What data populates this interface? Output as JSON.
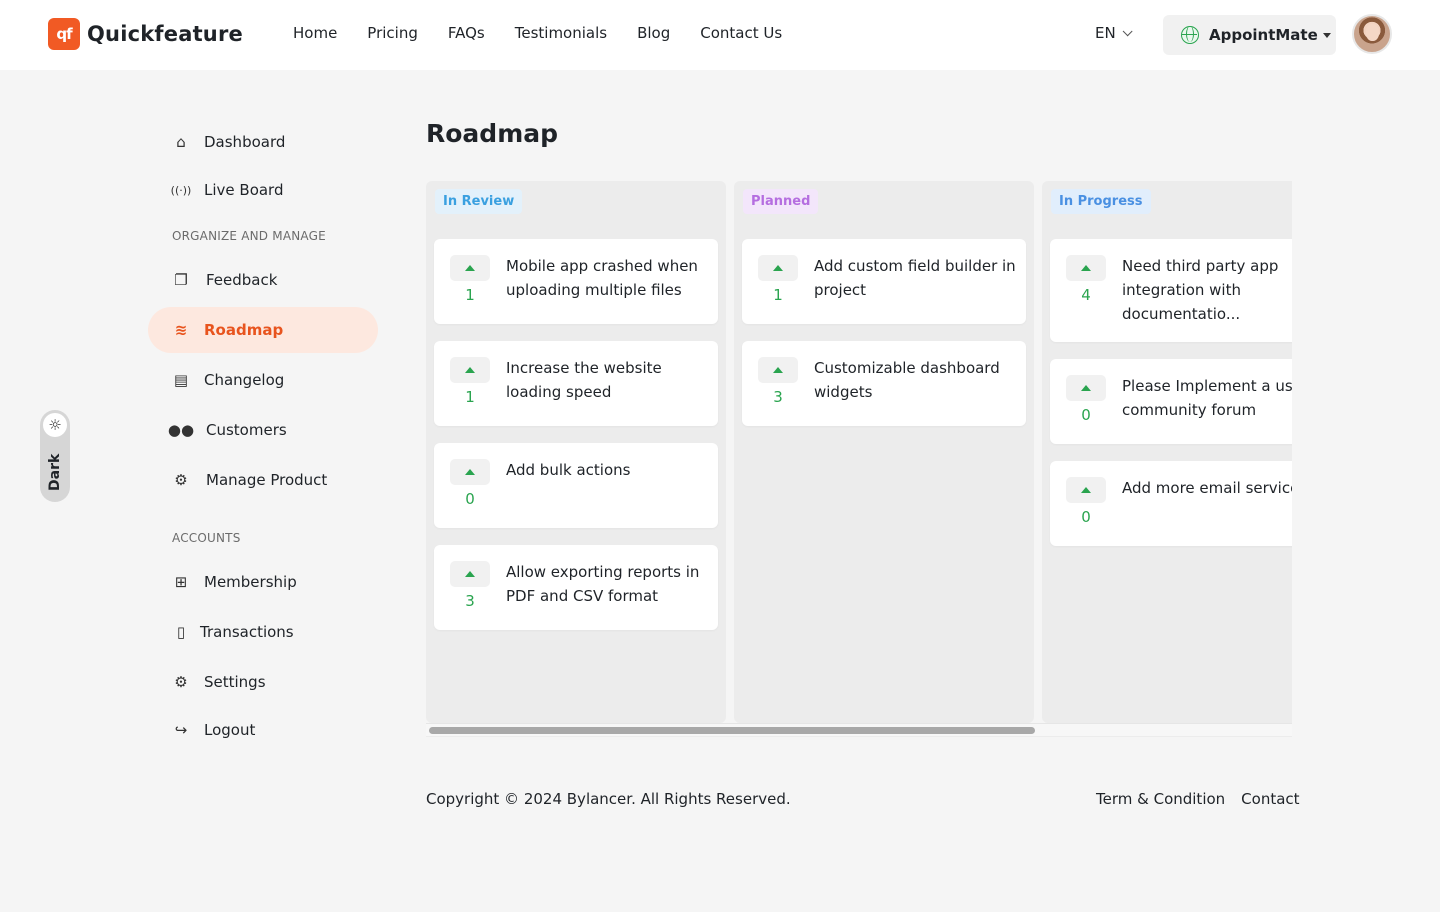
{
  "brand": {
    "logo_mark": "qf",
    "name": "Quickfeature",
    "accent": "#f15a24"
  },
  "nav": [
    {
      "label": "Home"
    },
    {
      "label": "Pricing"
    },
    {
      "label": "FAQs"
    },
    {
      "label": "Testimonials"
    },
    {
      "label": "Blog"
    },
    {
      "label": "Contact Us"
    }
  ],
  "header": {
    "language": "EN",
    "workspace": "AppointMate"
  },
  "sidebar": {
    "main_items": [
      {
        "label": "Dashboard",
        "icon": "home-icon",
        "glyph": "⌂"
      },
      {
        "label": "Live Board",
        "icon": "broadcast-icon",
        "glyph": "(·)"
      }
    ],
    "section_organize": "ORGANIZE AND MANAGE",
    "organize_items": [
      {
        "label": "Feedback",
        "icon": "folders-icon",
        "glyph": "❐"
      },
      {
        "label": "Roadmap",
        "icon": "layers-icon",
        "glyph": "≋",
        "active": true
      },
      {
        "label": "Changelog",
        "icon": "message-icon",
        "glyph": "▤"
      },
      {
        "label": "Customers",
        "icon": "users-icon",
        "glyph": "👥"
      },
      {
        "label": "Manage Product",
        "icon": "gears-icon",
        "glyph": "⚙"
      }
    ],
    "section_accounts": "ACCOUNTS",
    "account_items": [
      {
        "label": "Membership",
        "icon": "gift-icon",
        "glyph": "🎁"
      },
      {
        "label": "Transactions",
        "icon": "document-icon",
        "glyph": "▯"
      },
      {
        "label": "Settings",
        "icon": "settings-icon",
        "glyph": "⚙"
      },
      {
        "label": "Logout",
        "icon": "logout-icon",
        "glyph": "↪"
      }
    ]
  },
  "theme_toggle": {
    "label": "Dark",
    "icon": "sun-icon"
  },
  "main": {
    "title": "Roadmap",
    "columns": [
      {
        "status": "In Review",
        "badge_bg": "#e3f1fb",
        "badge_fg": "#3aa0e0",
        "cards": [
          {
            "title": "Mobile app crashed when uploading multiple files",
            "votes": "1"
          },
          {
            "title": "Increase the website loading speed",
            "votes": "1"
          },
          {
            "title": "Add bulk actions",
            "votes": "0"
          },
          {
            "title": "Allow exporting reports in PDF and CSV format",
            "votes": "3"
          }
        ]
      },
      {
        "status": "Planned",
        "badge_bg": "#f3e6fb",
        "badge_fg": "#b56ee0",
        "cards": [
          {
            "title": "Add custom field builder in project",
            "votes": "1"
          },
          {
            "title": "Customizable dashboard widgets",
            "votes": "3"
          }
        ]
      },
      {
        "status": "In Progress",
        "badge_bg": "#e1eefc",
        "badge_fg": "#4a90e2",
        "cards": [
          {
            "title": "Need third party app integration with documentatio...",
            "votes": "4"
          },
          {
            "title": "Please Implement a user community forum",
            "votes": "0"
          },
          {
            "title": "Add more email services",
            "votes": "0"
          }
        ]
      }
    ]
  },
  "footer": {
    "copyright": "Copyright © 2024 Bylancer. All Rights Reserved.",
    "links": [
      "Term & Condition",
      "Contact"
    ]
  }
}
